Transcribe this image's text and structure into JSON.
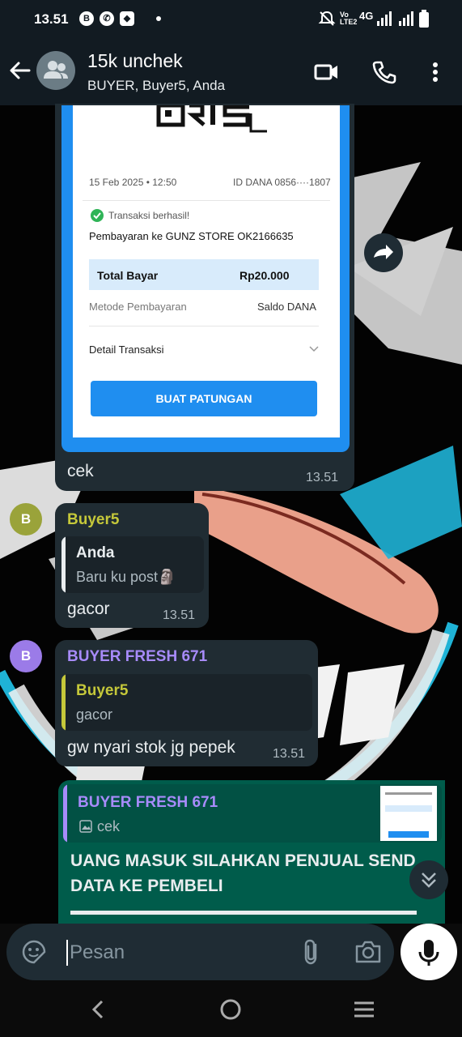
{
  "status_bar": {
    "time": "13.51",
    "notif_icons": [
      "B",
      "whatsapp-icon",
      "app-icon"
    ],
    "right_label": "Vo LTE2",
    "network": "4G"
  },
  "header": {
    "title": "15k unchek",
    "subtitle": "BUYER, Buyer5, Anda"
  },
  "receipt": {
    "logo": "QRIS",
    "date": "15 Feb 2025 • 12:50",
    "dana_id": "ID DANA 0856····1807",
    "status": "Transaksi berhasil!",
    "payee": "Pembayaran ke GUNZ STORE OK2166635",
    "total_label": "Total Bayar",
    "total_value": "Rp20.000",
    "method_label": "Metode Pembayaran",
    "method_value": "Saldo DANA",
    "detail_label": "Detail Transaksi",
    "button_label": "BUAT PATUNGAN"
  },
  "messages": [
    {
      "caption": "cek",
      "time": "13.51"
    },
    {
      "avatar_letter": "B",
      "sender": "Buyer5",
      "quote_name": "Anda",
      "quote_text": "Baru ku post🗿",
      "text": "gacor",
      "time": "13.51"
    },
    {
      "avatar_letter": "B",
      "sender": "BUYER FRESH 671",
      "quote_name": "Buyer5",
      "quote_text": "gacor",
      "text": "gw nyari stok jg pepek",
      "time": "13.51"
    },
    {
      "quote_name": "BUYER FRESH 671",
      "quote_text": "cek",
      "text": "UANG MASUK SILAHKAN PENJUAL SEND DATA KE PEMBELI"
    }
  ],
  "input": {
    "placeholder": "Pesan"
  },
  "colors": {
    "header_bg": "#121b22",
    "incoming_bubble": "#202c33",
    "outgoing_bubble": "#005c4b",
    "buyer5_name": "#c5c83a",
    "buyer_fresh_name": "#a78bfa",
    "accent_blue": "#1f8ef0"
  }
}
